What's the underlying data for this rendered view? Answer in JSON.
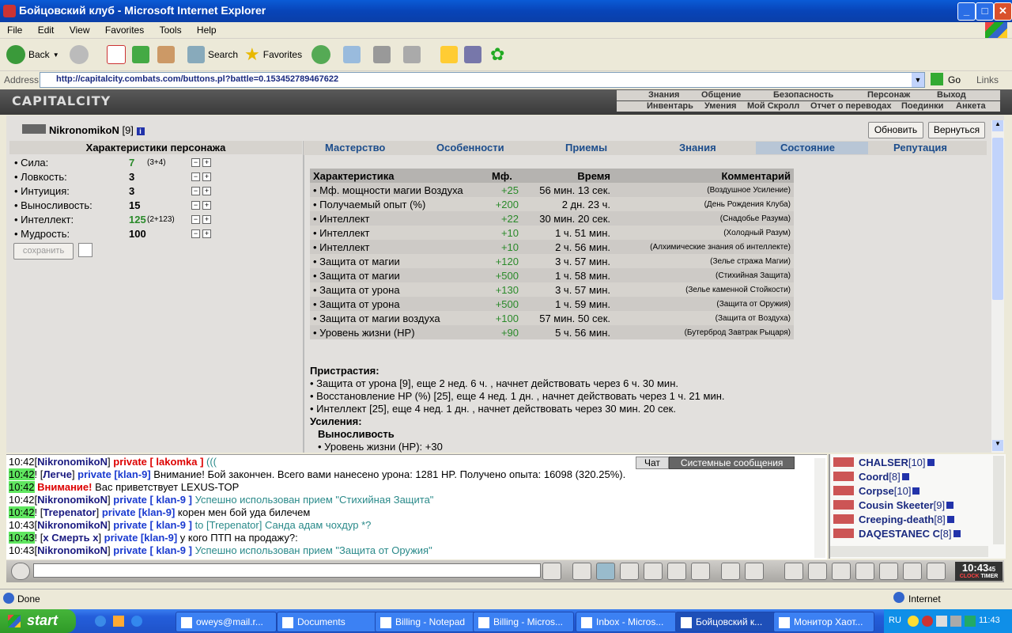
{
  "window": {
    "title": "Бойцовский клуб - Microsoft Internet Explorer"
  },
  "menu": [
    "File",
    "Edit",
    "View",
    "Favorites",
    "Tools",
    "Help"
  ],
  "toolbar": {
    "back": "Back",
    "search": "Search",
    "favorites": "Favorites"
  },
  "address": {
    "label": "Address",
    "url": "http://capitalcity.combats.com/buttons.pl?battle=0.153452789467622",
    "go": "Go",
    "links": "Links"
  },
  "game": {
    "logo": "CAPITALCITY",
    "nav_top": [
      "Знания",
      "Общение",
      "Безопасность",
      "Персонаж",
      "Выход"
    ],
    "nav_bottom": [
      "Инвентарь",
      "Умения",
      "Мой Скролл",
      "Отчет о переводах",
      "Поединки",
      "Анкета"
    ],
    "char_name": "NikronomikoN",
    "char_level": "[9]",
    "refresh_btn": "Обновить",
    "return_btn": "Вернуться",
    "stats_title": "Характеристики персонажа",
    "stats": [
      {
        "name": "Сила:",
        "value": "7",
        "extra": "(3+4)",
        "green": true
      },
      {
        "name": "Ловкость:",
        "value": "3",
        "extra": ""
      },
      {
        "name": "Интуиция:",
        "value": "3",
        "extra": ""
      },
      {
        "name": "Выносливость:",
        "value": "15",
        "extra": ""
      },
      {
        "name": "Интеллект:",
        "value": "125",
        "extra": "(2+123)",
        "green": true
      },
      {
        "name": "Мудрость:",
        "value": "100",
        "extra": ""
      }
    ],
    "save_btn": "сохранить",
    "tabs": [
      "Мастерство",
      "Особенности",
      "Приемы",
      "Знания",
      "Состояние",
      "Репутация"
    ],
    "active_tab": "Состояние",
    "table_headers": [
      "Характеристика",
      "Мф.",
      "Время",
      "Комментарий"
    ],
    "effects": [
      [
        "• Мф. мощности магии Воздуха",
        "+25",
        "56 мин. 13 сек.",
        "(Воздушное Усиление)"
      ],
      [
        "• Получаемый опыт (%)",
        "+200",
        "2 дн. 23 ч.",
        "(День Рождения Клуба)"
      ],
      [
        "• Интеллект",
        "+22",
        "30 мин. 20 сек.",
        "(Снадобье Разума)"
      ],
      [
        "• Интеллект",
        "+10",
        "1 ч. 51 мин.",
        "(Холодный Разум)"
      ],
      [
        "• Интеллект",
        "+10",
        "2 ч. 56 мин.",
        "(Алхимические знания об интеллекте)"
      ],
      [
        "• Защита от магии",
        "+120",
        "3 ч. 57 мин.",
        "(Зелье стража Магии)"
      ],
      [
        "• Защита от магии",
        "+500",
        "1 ч. 58 мин.",
        "(Стихийная Защита)"
      ],
      [
        "• Защита от урона",
        "+130",
        "3 ч. 57 мин.",
        "(Зелье каменной Стойкости)"
      ],
      [
        "• Защита от урона",
        "+500",
        "1 ч. 59 мин.",
        "(Защита от Оружия)"
      ],
      [
        "• Защита от магии воздуха",
        "+100",
        "57 мин. 50 сек.",
        "(Защита от Воздуха)"
      ],
      [
        "• Уровень жизни (HP)",
        "+90",
        "5 ч. 56 мин.",
        "(Бутерброд Завтрак Рыцаря)"
      ]
    ],
    "addictions_title": "Пристрастия:",
    "addictions": [
      "• Защита от урона [9], еще 2 нед. 6 ч. , начнет действовать через 6 ч. 30 мин.",
      "• Восстановление HP (%) [25], еще 4 нед. 1 дн. , начнет действовать через 1 ч. 21 мин.",
      "• Интеллект [25], еще 4 нед. 1 дн. , начнет действовать через 30 мин. 20 сек."
    ],
    "boosts_title": "Усиления:",
    "boost_sub": "Выносливость",
    "boost_item": "• Уровень жизни (HP): +30"
  },
  "chat": {
    "tab_chat": "Чат",
    "tab_system": "Системные сообщения",
    "lines": [
      {
        "time": "10:42",
        "hl": false,
        "pre": "[",
        "nick": "NikronomikoN",
        "post": "] ",
        "ptype": "red",
        "priv": "private [ lakomka ]",
        "msg": " (((",
        "msgclass": "gr"
      },
      {
        "time": "10:42",
        "hl": true,
        "pre": "! [",
        "nick": "Легче",
        "post": "] ",
        "ptype": "blue",
        "priv": "private [klan-9]",
        "msg": " Внимание! Бой закончен. Всего вами нанесено урона: 1281 HP. Получено опыта: 16098 (320.25%).",
        "msgclass": ""
      },
      {
        "time": "10:42",
        "hl": true,
        "pre": " ",
        "nick": "",
        "post": "",
        "ptype": "red",
        "priv": "Внимание!",
        "msg": " Вас приветствует LEXUS-TOP",
        "msgclass": ""
      },
      {
        "time": "10:42",
        "hl": false,
        "pre": "[",
        "nick": "NikronomikoN",
        "post": "] ",
        "ptype": "blue",
        "priv": "private [ klan-9 ]",
        "msg": " Успешно использован прием \"Стихийная Защита\"",
        "msgclass": "gr"
      },
      {
        "time": "10:42",
        "hl": true,
        "pre": "! [",
        "nick": "Trepenator",
        "post": "] ",
        "ptype": "blue",
        "priv": "private [klan-9]",
        "msg": " корен мен бой уда билечем",
        "msgclass": ""
      },
      {
        "time": "10:43",
        "hl": false,
        "pre": "[",
        "nick": "NikronomikoN",
        "post": "] ",
        "ptype": "blue",
        "priv": "private [ klan-9 ]",
        "msg": " to [Trepenator] Санда адам чохдур *?",
        "msgclass": "gr"
      },
      {
        "time": "10:43",
        "hl": true,
        "pre": "! [",
        "nick": "x Смерть x",
        "post": "] ",
        "ptype": "blue",
        "priv": "private [klan-9]",
        "msg": " у кого ПТП на продажу?:",
        "msgclass": ""
      },
      {
        "time": "10:43",
        "hl": false,
        "pre": "[",
        "nick": "NikronomikoN",
        "post": "] ",
        "ptype": "blue",
        "priv": "private [ klan-9 ]",
        "msg": " Успешно использован прием \"Защита от Оружия\"",
        "msgclass": "gr"
      }
    ]
  },
  "users": [
    {
      "name": "CHALSER",
      "level": "[10]"
    },
    {
      "name": "Coord",
      "level": "[8]"
    },
    {
      "name": "Corpse",
      "level": "[10]"
    },
    {
      "name": "Cousin Skeeter",
      "level": "[9]"
    },
    {
      "name": "Creeping-death",
      "level": "[8]"
    },
    {
      "name": "DAQESTANEC C",
      "level": "[8]"
    }
  ],
  "clock": {
    "time": "10:43",
    "sec": "45",
    "label1": "CLOCK",
    "label2": "TIMER"
  },
  "status": {
    "text": "Done",
    "zone": "Internet"
  },
  "taskbar": {
    "start": "start",
    "tasks": [
      "oweys@mail.r...",
      "Documents",
      "Billing - Notepad",
      "Billing - Micros...",
      "Inbox - Micros...",
      "Бойцовский к...",
      "Монитор Хаот..."
    ],
    "lang": "RU",
    "time": "11:43"
  }
}
